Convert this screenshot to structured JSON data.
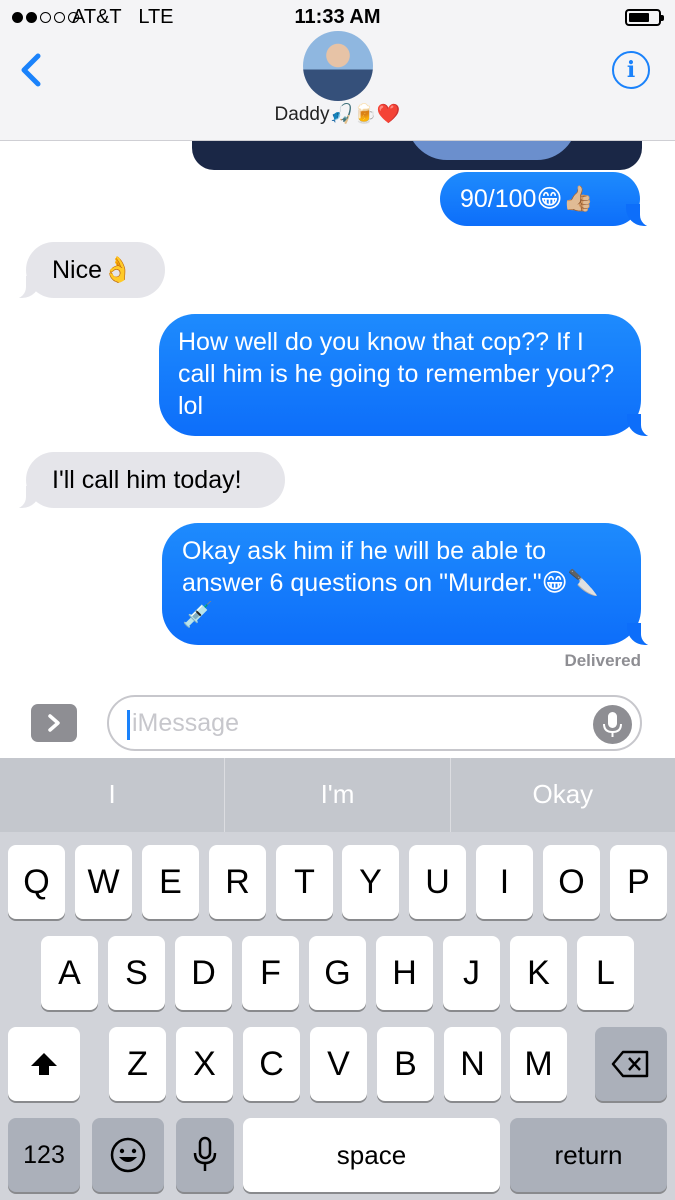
{
  "status_bar": {
    "carrier": "AT&T",
    "network": "LTE",
    "time": "11:33 AM"
  },
  "nav": {
    "contact_name": "Daddy🎣🍺❤️"
  },
  "messages": [
    {
      "from": "me",
      "text": "90/100😁👍🏼"
    },
    {
      "from": "them",
      "text": "Nice👌"
    },
    {
      "from": "me",
      "text": "How well do you know that cop?? If I call him is he going to remember you?? lol"
    },
    {
      "from": "them",
      "text": "I'll call him today!"
    },
    {
      "from": "me",
      "text": "Okay ask him if he will be able to answer 6 questions on \"Murder.\"😁🔪💉"
    }
  ],
  "delivery_status": "Delivered",
  "composer": {
    "placeholder": "iMessage"
  },
  "keyboard": {
    "suggestions": [
      "I",
      "I'm",
      "Okay"
    ],
    "row1": [
      "Q",
      "W",
      "E",
      "R",
      "T",
      "Y",
      "U",
      "I",
      "O",
      "P"
    ],
    "row2": [
      "A",
      "S",
      "D",
      "F",
      "G",
      "H",
      "J",
      "K",
      "L"
    ],
    "row3": [
      "Z",
      "X",
      "C",
      "V",
      "B",
      "N",
      "M"
    ],
    "numbers_label": "123",
    "space_label": "space",
    "return_label": "return"
  },
  "colors": {
    "accent": "#1a82fb",
    "outgoing_bubble": "#1b85fc",
    "incoming_bubble": "#e5e5ea"
  },
  "icons": [
    "back-chevron-icon",
    "info-icon",
    "app-drawer-chevron-icon",
    "microphone-icon",
    "shift-arrow-icon",
    "delete-icon",
    "emoji-icon",
    "dictation-icon"
  ]
}
